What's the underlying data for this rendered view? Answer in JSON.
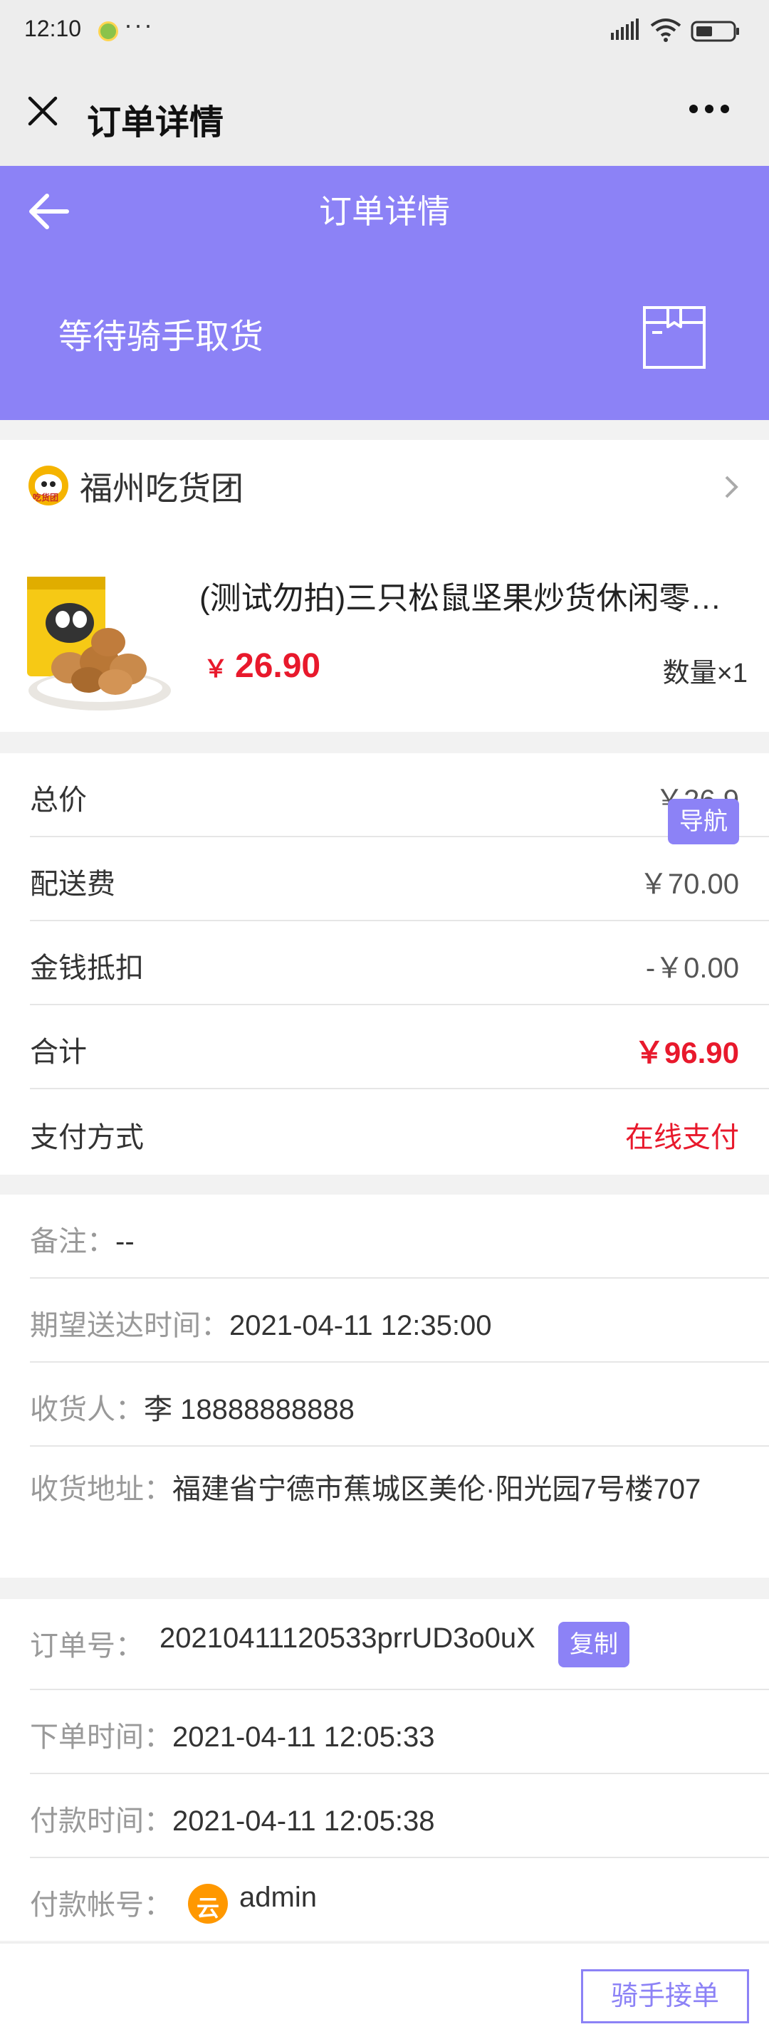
{
  "status_bar": {
    "time": "12:10",
    "dots": "···"
  },
  "navbar": {
    "title": "订单详情"
  },
  "header": {
    "title": "订单详情",
    "status": "等待骑手取货"
  },
  "shop": {
    "name": "福州吃货团",
    "logo_text": "吃货团",
    "product": {
      "name": "(测试勿拍)三只松鼠坚果炒货休闲零食碧根果",
      "currency": "￥",
      "price": "26.90",
      "quantity": "数量×1"
    }
  },
  "prices": {
    "total_label": "总价",
    "total_value": "￥26.9",
    "delivery_label": "配送费",
    "delivery_value": "￥70.00",
    "discount_label": "金钱抵扣",
    "discount_value": "-￥0.00",
    "sum_label": "合计",
    "sum_value": "￥96.90",
    "payment_label": "支付方式",
    "payment_value": "在线支付"
  },
  "delivery_info": {
    "remark_label": "备注：",
    "remark_value": "--",
    "expected_label": "期望送达时间：",
    "expected_value": "2021-04-11 12:35:00",
    "receiver_label": "收货人：",
    "receiver_value": "李 18888888888",
    "address_label": "收货地址：",
    "address_value": "福建省宁德市蕉城区美伦·阳光园7号楼707",
    "nav_button": "导航"
  },
  "order_info": {
    "order_no_label": "订单号：",
    "order_no_value": "20210411120533prrUD3o0uX",
    "copy_button": "复制",
    "order_time_label": "下单时间：",
    "order_time_value": "2021-04-11 12:05:33",
    "pay_time_label": "付款时间：",
    "pay_time_value": "2021-04-11 12:05:38",
    "pay_account_label": "付款帐号：",
    "pay_account_icon_text": "云",
    "pay_account_value": "admin"
  },
  "bottom": {
    "rider_button": "骑手接单"
  },
  "colors": {
    "accent": "#8c82f6",
    "price_red": "#e8192c"
  }
}
